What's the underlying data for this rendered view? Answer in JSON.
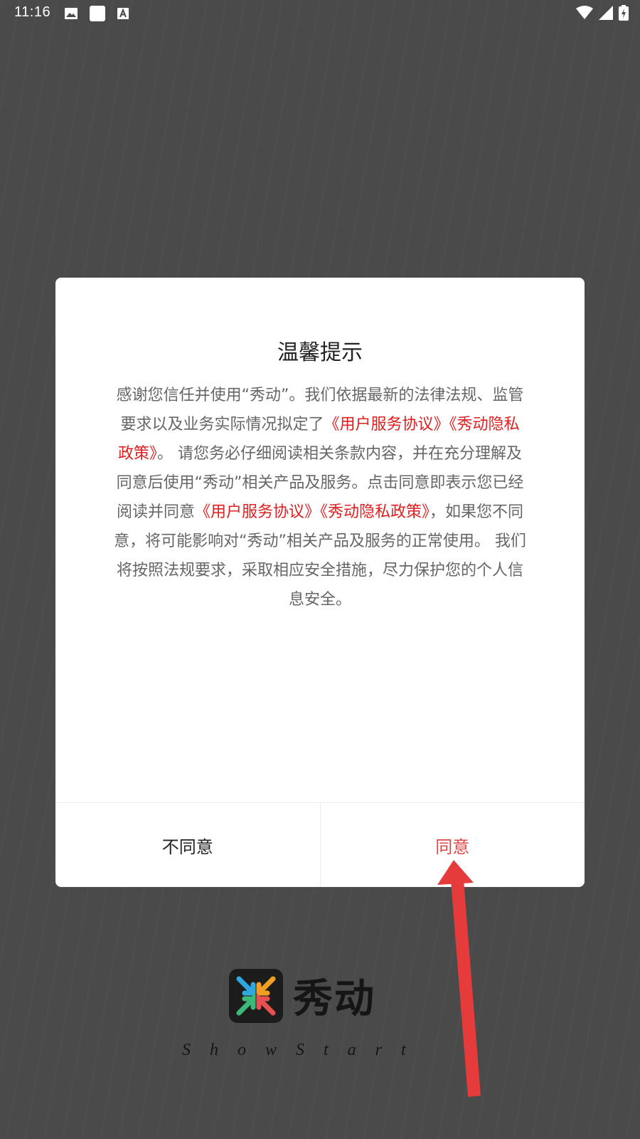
{
  "status_bar": {
    "time": "11:16",
    "left_icons": [
      "image-icon",
      "white-square-icon",
      "font-a-icon"
    ],
    "right_icons": [
      "wifi-icon",
      "cell-signal-icon",
      "battery-charging-icon"
    ]
  },
  "dialog": {
    "title": "温馨提示",
    "message": {
      "part1": "感谢您信任并使用“秀动”。我们依据最新的法律法规、监管要求以及业务实际情况拟定了",
      "link1": "《用户服务协议》《秀动隐私政策》",
      "part2": "。 请您务必仔细阅读相关条款内容，并在充分理解及同意后使用“秀动”相关产品及服务。点击同意即表示您已经阅读并同意",
      "link2": "《用户服务协议》《秀动隐私政策》",
      "part3": "，如果您不同意，将可能影响对“秀动”相关产品及服务的正常使用。 我们将按照法规要求，采取相应安全措施，尽力保护您的个人信息安全。"
    },
    "disagree_label": "不同意",
    "agree_label": "同意"
  },
  "brand": {
    "name": "秀动",
    "tagline": "ShowStart",
    "logo_icon": "arrows-converging-logo"
  },
  "annotation": {
    "arrow_icon": "red-arrow-pointer",
    "arrow_color": "#e53b3b"
  },
  "colors": {
    "background": "#4a4a4a",
    "link": "#e02020",
    "agree": "#e04848"
  }
}
